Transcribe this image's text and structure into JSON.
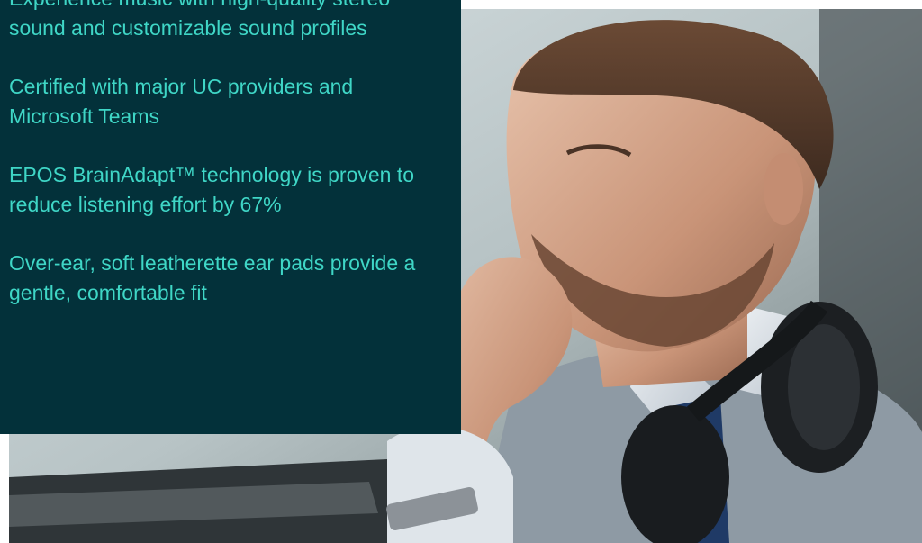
{
  "features": {
    "items": [
      {
        "text": "Experience music with high-quality stereo sound and customizable sound profiles"
      },
      {
        "text": "Certified with major UC providers and Microsoft Teams"
      },
      {
        "text": "EPOS BrainAdapt™ technology is proven to reduce listening effort by 67%"
      },
      {
        "text": "Over-ear, soft leatherette ear pads provide a gentle, comfortable fit"
      }
    ]
  },
  "colors": {
    "panel_bg": "#03313a",
    "feature_text": "#3fd6c6",
    "page_bg": "#ffffff"
  },
  "hero_image": {
    "subject_icon": "man-with-headphones-photo"
  }
}
